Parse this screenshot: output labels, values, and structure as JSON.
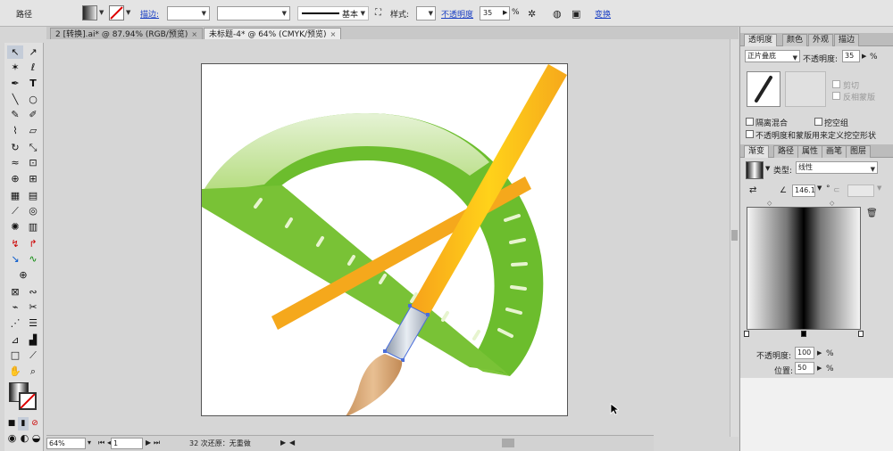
{
  "control_bar": {
    "object_type": "路径",
    "stroke_label": "描边:",
    "stroke_profile": "基本",
    "style_label": "样式:",
    "opacity_label": "不透明度",
    "opacity_value": "35",
    "opacity_unit": "%",
    "transform_label": "变换"
  },
  "document_tabs": [
    {
      "label": "2 [转换].ai* @ 87.94% (RGB/预览)",
      "close": "×",
      "active": false
    },
    {
      "label": "未标题-4* @ 64% (CMYK/预览)",
      "close": "×",
      "active": true
    }
  ],
  "status_bar": {
    "zoom": "64%",
    "page": "1",
    "info": "32 次还原：无重做"
  },
  "transparency_panel": {
    "tabs": [
      "透明度",
      "颜色",
      "外观",
      "描边"
    ],
    "blend_mode": "正片叠底",
    "opacity_label": "不透明度:",
    "opacity_value": "35",
    "opacity_unit": "%",
    "clip_label": "剪切",
    "invert_mask_label": "反相蒙版",
    "isolate_blending_label": "隔离混合",
    "knockout_group_label": "挖空组",
    "opacity_mask_label": "不透明度和蒙版用来定义挖空形状"
  },
  "gradient_panel": {
    "tabs": [
      "渐变",
      "路径",
      "属性",
      "画笔",
      "图层"
    ],
    "type_label": "类型:",
    "type_value": "线性",
    "angle_value": "146.1",
    "angle_unit": "°",
    "stop_opacity_label": "不透明度:",
    "stop_opacity_value": "100",
    "stop_opacity_unit": "%",
    "location_label": "位置:",
    "location_value": "50",
    "location_unit": "%"
  },
  "colors": {
    "protractor_green": "#6cbd2d",
    "ruler_orange": "#f5a81c",
    "brush_yellow": "#ffd21a",
    "brush_tip": "#d9a877"
  }
}
